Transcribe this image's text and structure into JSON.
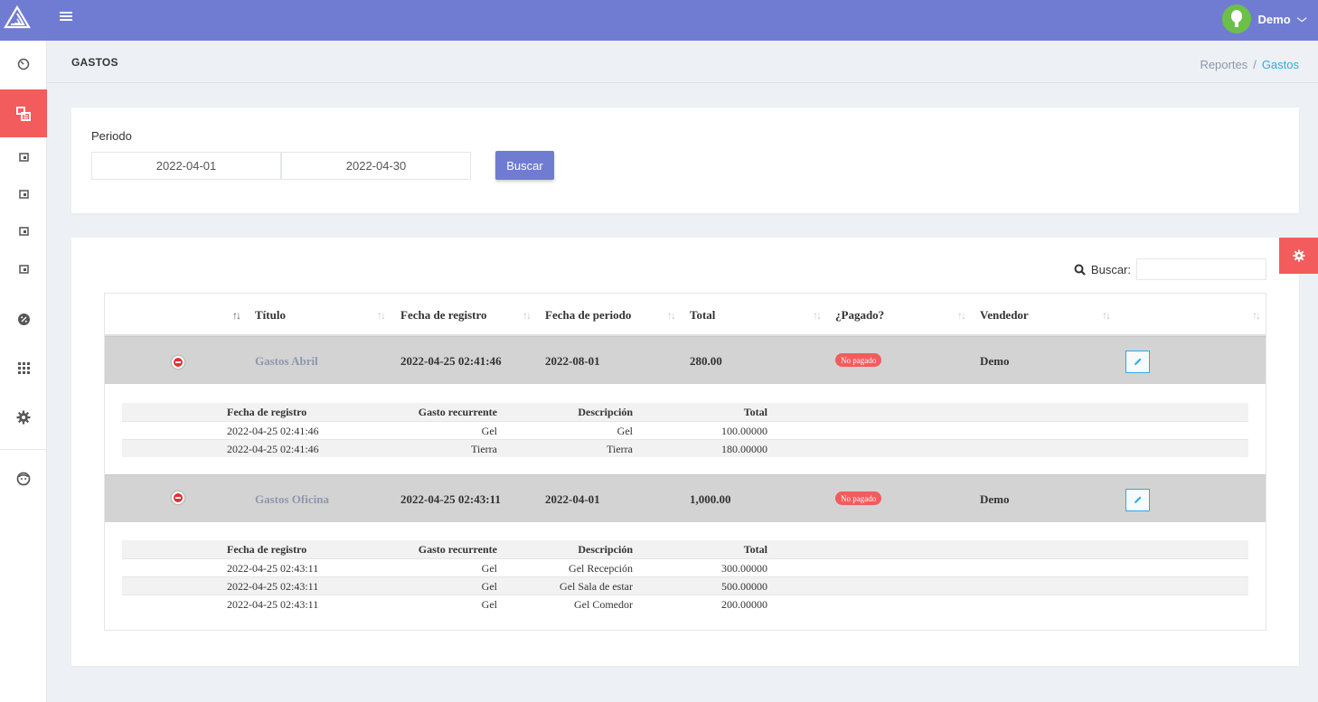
{
  "user": {
    "name": "Demo"
  },
  "page": {
    "title": "GASTOS"
  },
  "breadcrumb": {
    "parent": "Reportes",
    "separator": "/",
    "current": "Gastos"
  },
  "filter": {
    "period_label": "Periodo",
    "date_from": "2022-04-01",
    "date_to": "2022-04-30",
    "search_button": "Buscar"
  },
  "table_search": {
    "label": "Buscar:",
    "value": ""
  },
  "sidebar": {
    "items": [
      {
        "icon": "dashboard-icon"
      },
      {
        "icon": "reports-icon",
        "active": true
      },
      {
        "icon": "calendar-icon"
      },
      {
        "icon": "calendar-icon"
      },
      {
        "icon": "calendar-icon"
      },
      {
        "icon": "calendar-icon"
      },
      {
        "icon": "percent-badge-icon"
      },
      {
        "icon": "grid-icon"
      },
      {
        "icon": "gear-icon"
      },
      {
        "icon": "face-icon"
      }
    ]
  },
  "columns": {
    "titulo": "Título",
    "fecha_registro": "Fecha de registro",
    "fecha_periodo": "Fecha de periodo",
    "total": "Total",
    "pagado": "¿Pagado?",
    "vendedor": "Vendedor"
  },
  "sub_columns": {
    "fecha_registro": "Fecha de registro",
    "gasto_recurrente": "Gasto recurrente",
    "descripcion": "Descripción",
    "total": "Total"
  },
  "rows": [
    {
      "titulo": "Gastos Abril",
      "fecha_registro": "2022-04-25 02:41:46",
      "fecha_periodo": "2022-08-01",
      "total": "280.00",
      "pagado": "No pagado",
      "vendedor": "Demo",
      "details": [
        {
          "fecha_registro": "2022-04-25 02:41:46",
          "gasto_recurrente": "Gel",
          "descripcion": "Gel",
          "total": "100.00000"
        },
        {
          "fecha_registro": "2022-04-25 02:41:46",
          "gasto_recurrente": "Tierra",
          "descripcion": "Tierra",
          "total": "180.00000"
        }
      ]
    },
    {
      "titulo": "Gastos Oficina",
      "fecha_registro": "2022-04-25 02:43:11",
      "fecha_periodo": "2022-04-01",
      "total": "1,000.00",
      "pagado": "No pagado",
      "vendedor": "Demo",
      "details": [
        {
          "fecha_registro": "2022-04-25 02:43:11",
          "gasto_recurrente": "Gel",
          "descripcion": "Gel Recepción",
          "total": "300.00000"
        },
        {
          "fecha_registro": "2022-04-25 02:43:11",
          "gasto_recurrente": "Gel",
          "descripcion": "Gel Sala de estar",
          "total": "500.00000"
        },
        {
          "fecha_registro": "2022-04-25 02:43:11",
          "gasto_recurrente": "Gel",
          "descripcion": "Gel Comedor",
          "total": "200.00000"
        }
      ]
    }
  ],
  "colors": {
    "topbar": "#707cd2",
    "accent": "#f25c5c",
    "link": "#2cabe3"
  }
}
